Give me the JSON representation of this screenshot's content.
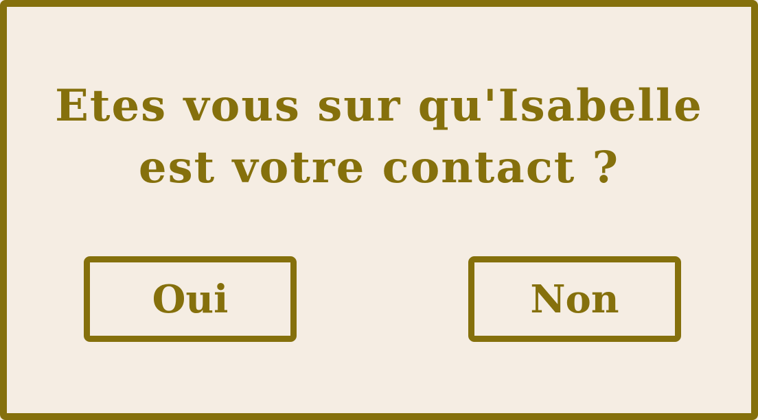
{
  "dialog": {
    "message_line1": "Etes vous sur qu'Isabelle",
    "message_line2": "est votre contact ?",
    "yes_label": "Oui",
    "no_label": "Non"
  },
  "colors": {
    "accent": "#85700c",
    "background": "#f5ede3"
  }
}
